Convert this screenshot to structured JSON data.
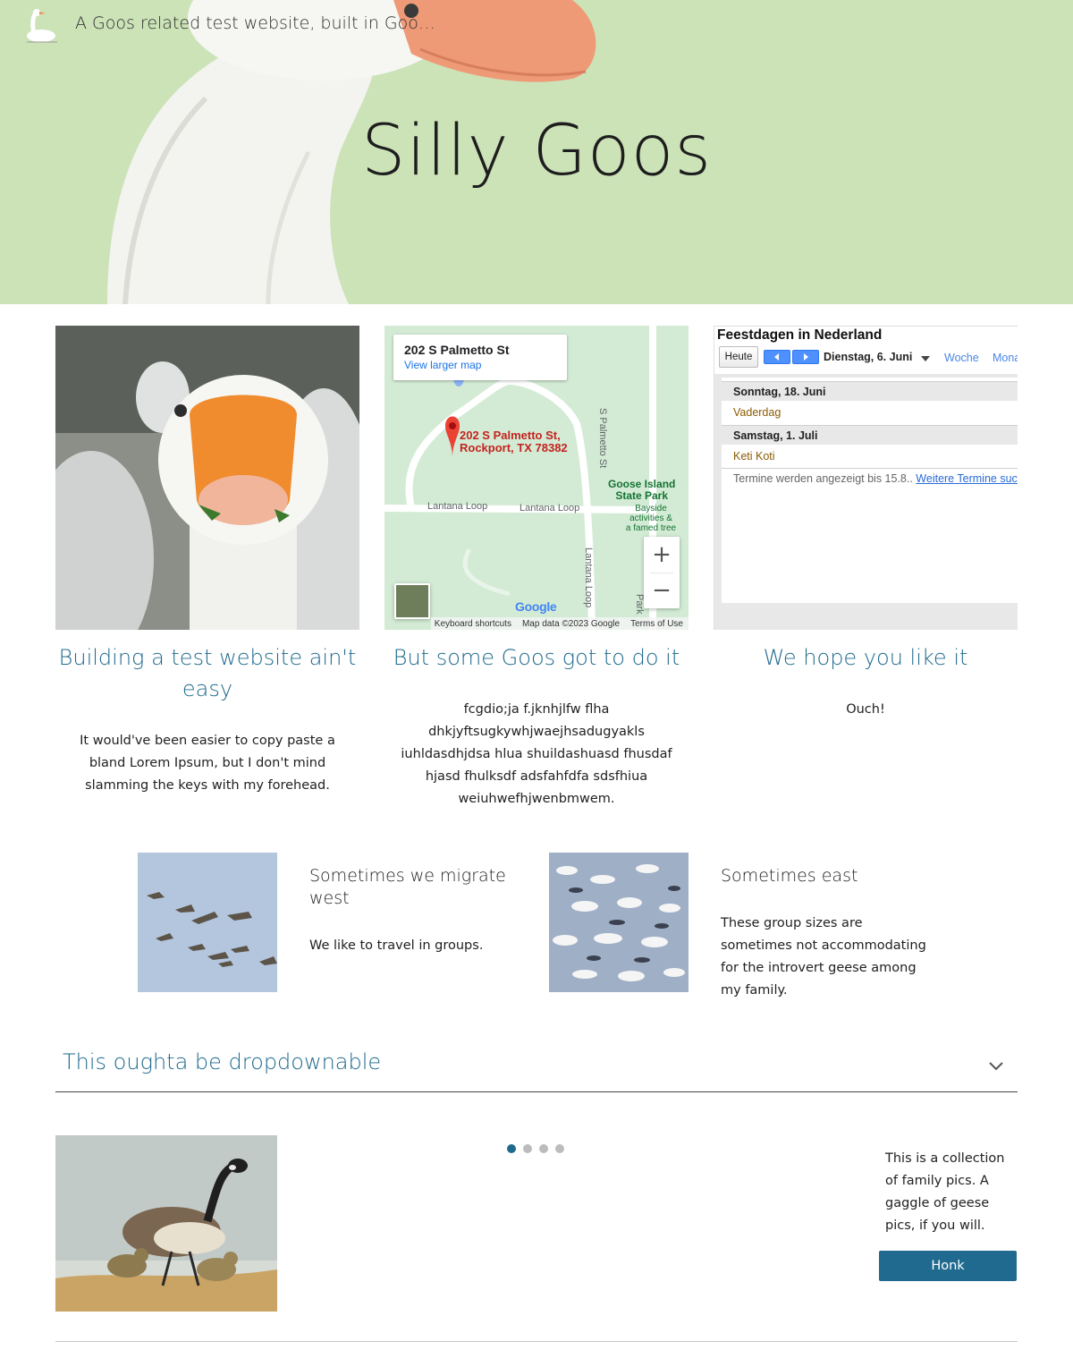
{
  "header": {
    "site_title": "A Goos related test website, built in Goo…",
    "hero_title": "Silly Goos"
  },
  "cards": [
    {
      "heading": "Building a test website ain't easy",
      "body": "It would've been easier to copy paste a bland Lorem Ipsum, but I don't mind slamming the keys with my forehead."
    },
    {
      "heading": "But some Goos got to do it",
      "body": "fcgdio;ja f.jknhjlfw flha dhkjyftsugkywhjwaejhsadugyakls  iuhldasdhjdsa hlua shuildashuasd fhusdaf hjasd fhulksdf adsfahfdfa sdsfhiua weiuhwefhjwenbmwem."
    },
    {
      "heading": "We hope you like it",
      "body": "Ouch!"
    }
  ],
  "map": {
    "place_title": "202 S Palmetto St",
    "view_larger": "View larger map",
    "pin_address_line1": "202 S Palmetto St,",
    "pin_address_line2": "Rockport, TX 78382",
    "street_1": "Lantana Loop",
    "street_2": "Lantana Loop",
    "street_3": "S Palmetto St",
    "street_4": "Lantana Loop",
    "street_5": "Park",
    "park_name_line1": "Goose Island",
    "park_name_line2": "State Park",
    "park_sub_line1": "Bayside",
    "park_sub_line2": "activities &",
    "park_sub_line3": "a famed tree",
    "google_logo": "Google",
    "footer_shortcuts": "Keyboard shortcuts",
    "footer_data": "Map data ©2023 Google",
    "footer_terms": "Terms of Use",
    "zoom_in": "+",
    "zoom_out": "−"
  },
  "calendar": {
    "title": "Feestdagen in Nederland",
    "today_label": "Heute",
    "current_date": "Dienstag, 6. Juni",
    "view_week": "Woche",
    "view_month": "Monat",
    "days": [
      {
        "date": "Sonntag, 18. Juni",
        "event": "Vaderdag"
      },
      {
        "date": "Samstag, 1. Juli",
        "event": "Keti Koti"
      }
    ],
    "more_text": "Termine werden angezeigt bis 15.8..",
    "more_link": "Weitere Termine suchen"
  },
  "migrate": [
    {
      "heading": "Sometimes we migrate west",
      "text": "We like to travel in groups."
    },
    {
      "heading": "Sometimes east",
      "text": "These group sizes are sometimes not accommodating for the introvert geese among my family."
    }
  ],
  "dropdown": {
    "title": "This oughta be dropdownable"
  },
  "carousel": {
    "slide_count": 4,
    "active_slide": 1,
    "side_text": "This is a collection of family pics. A gaggle of geese pics, if you will.",
    "button_label": "Honk"
  },
  "colors": {
    "accent": "#1e6a8d",
    "hero_bg": "#cce3b8",
    "button": "#216a8f"
  }
}
